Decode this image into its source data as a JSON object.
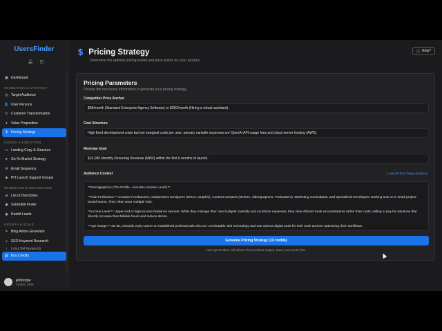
{
  "app": {
    "brand": "UsersFinder",
    "icons": [
      "bell-icon",
      "layout-icon"
    ]
  },
  "sidebar": {
    "items": [
      {
        "type": "item",
        "label": "Dashboard",
        "icon": "▦"
      },
      {
        "type": "section",
        "label": "FOUNDATION & STRATEGY"
      },
      {
        "type": "item",
        "label": "Target Audience",
        "icon": "◎"
      },
      {
        "type": "item",
        "label": "User Persons",
        "icon": "👤"
      },
      {
        "type": "item",
        "label": "Customer Transformation",
        "icon": "↻"
      },
      {
        "type": "item",
        "label": "Value Proposition",
        "icon": "✦"
      },
      {
        "type": "item",
        "label": "Pricing Strategy",
        "icon": "$",
        "active": true
      },
      {
        "type": "section",
        "label": "LAUNCH & EXECUTION"
      },
      {
        "type": "item",
        "label": "Landing Copy & Structure",
        "icon": "▭"
      },
      {
        "type": "item",
        "label": "Go-To-Market Strategy",
        "icon": "➤"
      },
      {
        "type": "item",
        "label": "Email Sequence",
        "icon": "✉"
      },
      {
        "type": "item",
        "label": "PH Launch Support Groups",
        "icon": "◈"
      },
      {
        "type": "section",
        "label": "PROMOTION & DISTRIBUTION"
      },
      {
        "type": "item",
        "label": "List of Directories",
        "icon": "☰"
      },
      {
        "type": "item",
        "label": "Subreddit Finder",
        "icon": "◉"
      },
      {
        "type": "item",
        "label": "Reddit Leads",
        "icon": "◉"
      },
      {
        "type": "section",
        "label": "GROWTH & SCALE"
      },
      {
        "type": "item",
        "label": "Blog Article Generator",
        "icon": "✎"
      },
      {
        "type": "item",
        "label": "SEO Keyword Research",
        "icon": "⌕"
      },
      {
        "type": "item",
        "label": "Long Tail Keywords",
        "icon": "⌕",
        "faded": true
      },
      {
        "type": "item",
        "label": "Buy Credits",
        "icon": "▤",
        "active": true
      }
    ],
    "user": {
      "name": "jefobozpe",
      "credits": "Credits: 2526"
    }
  },
  "header": {
    "title": "Pricing Strategy",
    "icon": "dollar-icon",
    "subtitle": "Determine the optimal pricing model and price points for your product.",
    "help_label": "Help?"
  },
  "card": {
    "title": "Pricing Parameters",
    "subtitle": "Provide the necessary information to generate your pricing strategy.",
    "fields": {
      "anchor_label": "Competitor Price Anchor",
      "anchor_value": "$99/month (Standard Enterprise Agency Software) or $350/month (Hiring a virtual assistant).",
      "cost_label": "Cost Structure",
      "cost_value": "High fixed development costs but low marginal costs per user; primary variable expenses are OpenAI API usage fees and cloud server hosting (AWS).",
      "revenue_label": "Revenue Goal",
      "revenue_value": "$10,000 Monthly Recurring Revenue (MRR) within the first 6 months of launch.",
      "audience_label": "Audience Context",
      "autofill_label": "Auto-fill from Target Audience",
      "audience_p1": "**Demographics (The Profile - includes Income Level):**",
      "audience_p2": "**Role Profession:** Creative Freelancers, Independent Designers (UI/UX, Graphic), Content Creators (Writers, Videographers, Podcasters), Marketing Consultants, and specialized Developers working solo or in small project-based teams. They often wear multiple hats.",
      "audience_p3": "**Income Level:** Upper-mid to high-income freelance earners. While they manage their own budgets carefully and scrutinize expenses, they view efficient tools as investments rather than costs, willing to pay for solutions that directly increase their billable hours and reduce stress.",
      "audience_p4": "**Age Range:** 25-45, primarily early-career to established professionals who are comfortable with technology and use various digital tools for their work and are optimizing their workflows."
    },
    "generate_label": "Generate Pricing Strategy (10 credits)",
    "note": "New generation will delete the previous output. Save your work first."
  },
  "colors": {
    "accent": "#1a73e8",
    "brand": "#4a9bff",
    "background": "#1b1b1d"
  }
}
